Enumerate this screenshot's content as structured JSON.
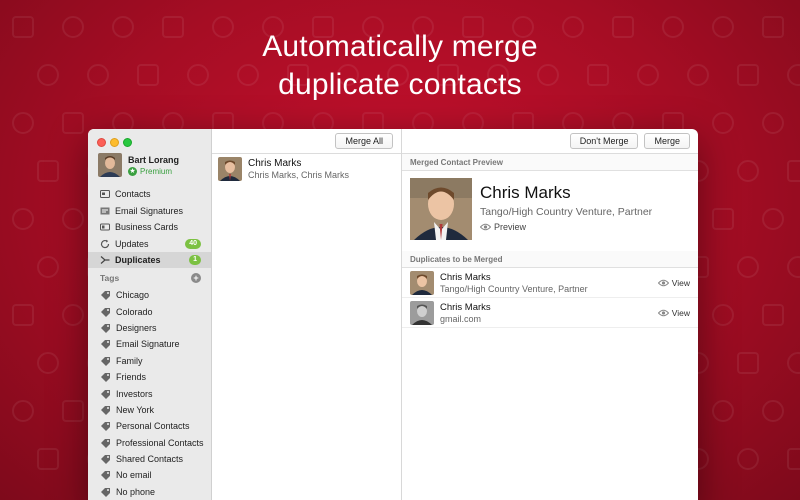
{
  "headline": {
    "line1": "Automatically merge",
    "line2": "duplicate contacts"
  },
  "colors": {
    "background": "#b40f28",
    "premium_green": "#3aa040",
    "count_badge": "#7cc142"
  },
  "account": {
    "name": "Bart Lorang",
    "plan": "Premium"
  },
  "sidebar": {
    "items": [
      {
        "label": "Contacts",
        "icon": "contacts-icon"
      },
      {
        "label": "Email Signatures",
        "icon": "email-signature-icon"
      },
      {
        "label": "Business Cards",
        "icon": "business-card-icon"
      },
      {
        "label": "Updates",
        "icon": "updates-icon",
        "count": "40"
      },
      {
        "label": "Duplicates",
        "icon": "duplicates-icon",
        "count": "1",
        "active": true
      }
    ],
    "tags_header": "Tags",
    "tags": [
      "Chicago",
      "Colorado",
      "Designers",
      "Email Signature",
      "Family",
      "Friends",
      "Investors",
      "New York",
      "Personal Contacts",
      "Professional Contacts",
      "Shared Contacts",
      "No email",
      "No phone"
    ]
  },
  "list": {
    "merge_all_label": "Merge All",
    "duplicates": [
      {
        "name": "Chris Marks",
        "sub": "Chris Marks, Chris Marks"
      }
    ]
  },
  "detail": {
    "dont_merge_label": "Don't Merge",
    "merge_label": "Merge",
    "preview_section": "Merged Contact Preview",
    "preview": {
      "name": "Chris Marks",
      "sub": "Tango/High Country Venture, Partner",
      "link": "Preview"
    },
    "duplicates_section": "Duplicates to be Merged",
    "rows": [
      {
        "name": "Chris Marks",
        "sub": "Tango/High Country Venture, Partner",
        "link": "View"
      },
      {
        "name": "Chris Marks",
        "sub": "gmail.com",
        "link": "View"
      }
    ]
  }
}
